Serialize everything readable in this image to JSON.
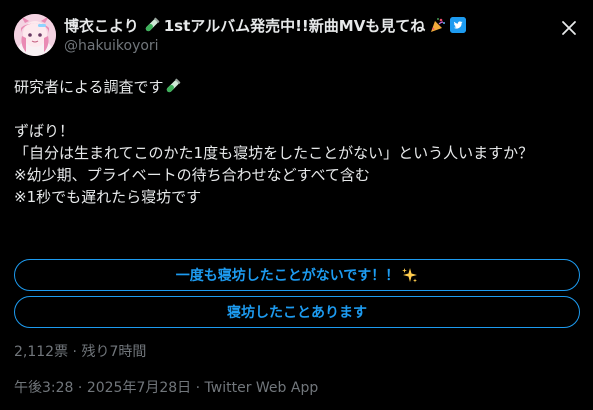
{
  "tweet": {
    "display_name": "博衣こより",
    "display_name_suffix": "1stアルバム発売中!!新曲MVも見てね",
    "handle": "@hakuikoyori",
    "body_lines": [
      "研究者による調査です",
      "",
      "ずばり！",
      "「自分は生まれてこのかた1度も寝坊をしたことがない」という人いますか？",
      "※幼少期、プライベートの待ち合わせなどすべて含む",
      "※1秒でも遅れたら寝坊です"
    ],
    "poll": {
      "options": [
        "一度も寝坊したことがないです！！",
        "寝坊したことあります"
      ],
      "votes_text": "2,112票",
      "separator": "·",
      "remaining_text": "残り7時間"
    },
    "footer": {
      "time": "午後3:28",
      "dot": "·",
      "date": "2025年7月28日",
      "source": "Twitter Web App"
    }
  },
  "icons": {
    "avatar": "avatar-image",
    "test-tube": "test-tube-icon",
    "party-popper": "party-popper-icon",
    "twitter-badge": "twitter-bird-badge-icon",
    "sparkles": "sparkles-icon",
    "close": "close-icon"
  },
  "colors": {
    "background": "#000000",
    "text": "#e7e9ea",
    "muted": "#71767b",
    "accent": "#1d9bf0"
  }
}
